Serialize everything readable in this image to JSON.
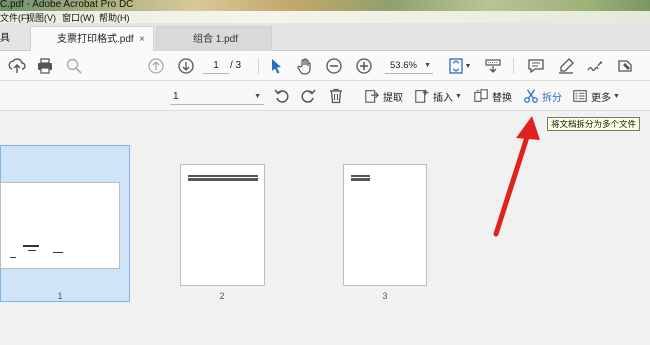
{
  "window": {
    "title": "C.pdf - Adobe Acrobat Pro DC"
  },
  "menu": {
    "items": [
      "文件(F)",
      "视图(V)",
      "窗口(W)",
      "帮助(H)"
    ]
  },
  "tabs": {
    "tools_label": "具",
    "active": {
      "label": "支票打印格式.pdf",
      "close": "×"
    },
    "inactive": {
      "label": "组合 1.pdf"
    }
  },
  "toolbar": {
    "page_current": "1",
    "page_total": "/ 3",
    "zoom": "53.6%"
  },
  "organize": {
    "page_select": "1",
    "extract": "提取",
    "insert": "插入",
    "replace": "替换",
    "split": "拆分",
    "more": "更多"
  },
  "tooltip": {
    "text": "将文档拆分为多个文件"
  },
  "thumbnails": [
    {
      "label": "1",
      "selected": true
    },
    {
      "label": "2",
      "selected": false
    },
    {
      "label": "3",
      "selected": false
    }
  ],
  "colors": {
    "accent": "#2a6fbf",
    "selection": "#cfe4f7",
    "arrow": "#e0211c"
  }
}
